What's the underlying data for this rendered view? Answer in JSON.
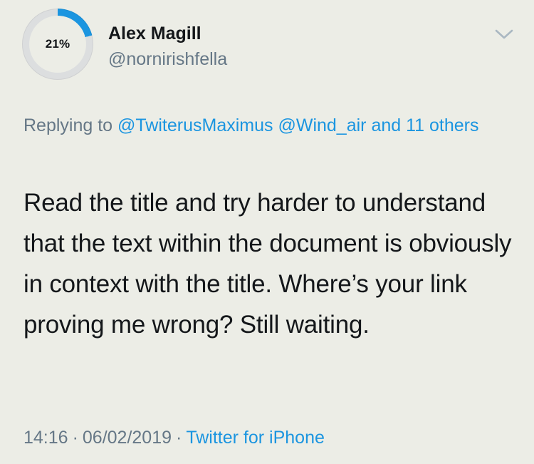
{
  "author": {
    "display_name": "Alex Magill",
    "handle": "@nornirishfella",
    "avatar_progress_text": "21%",
    "avatar_progress_fraction": 0.21
  },
  "reply": {
    "prefix": "Replying to",
    "mention_1": "@TwiterusMaximus",
    "mention_2": "@Wind_air",
    "others": "and 11 others"
  },
  "tweet": {
    "text": "Read the title and try harder to understand that the text within the document is obviously in context with the title. Where’s your link proving me wrong? Still waiting."
  },
  "meta": {
    "time": "14:16",
    "separator": "·",
    "date": "06/02/2019",
    "source": "Twitter for iPhone"
  },
  "icons": {
    "caret": "chevron-down-icon"
  },
  "colors": {
    "background": "#ecede6",
    "link": "#1b95e0",
    "secondary_text": "#657786",
    "primary_text": "#14171a",
    "progress_track": "#dcdedf"
  }
}
